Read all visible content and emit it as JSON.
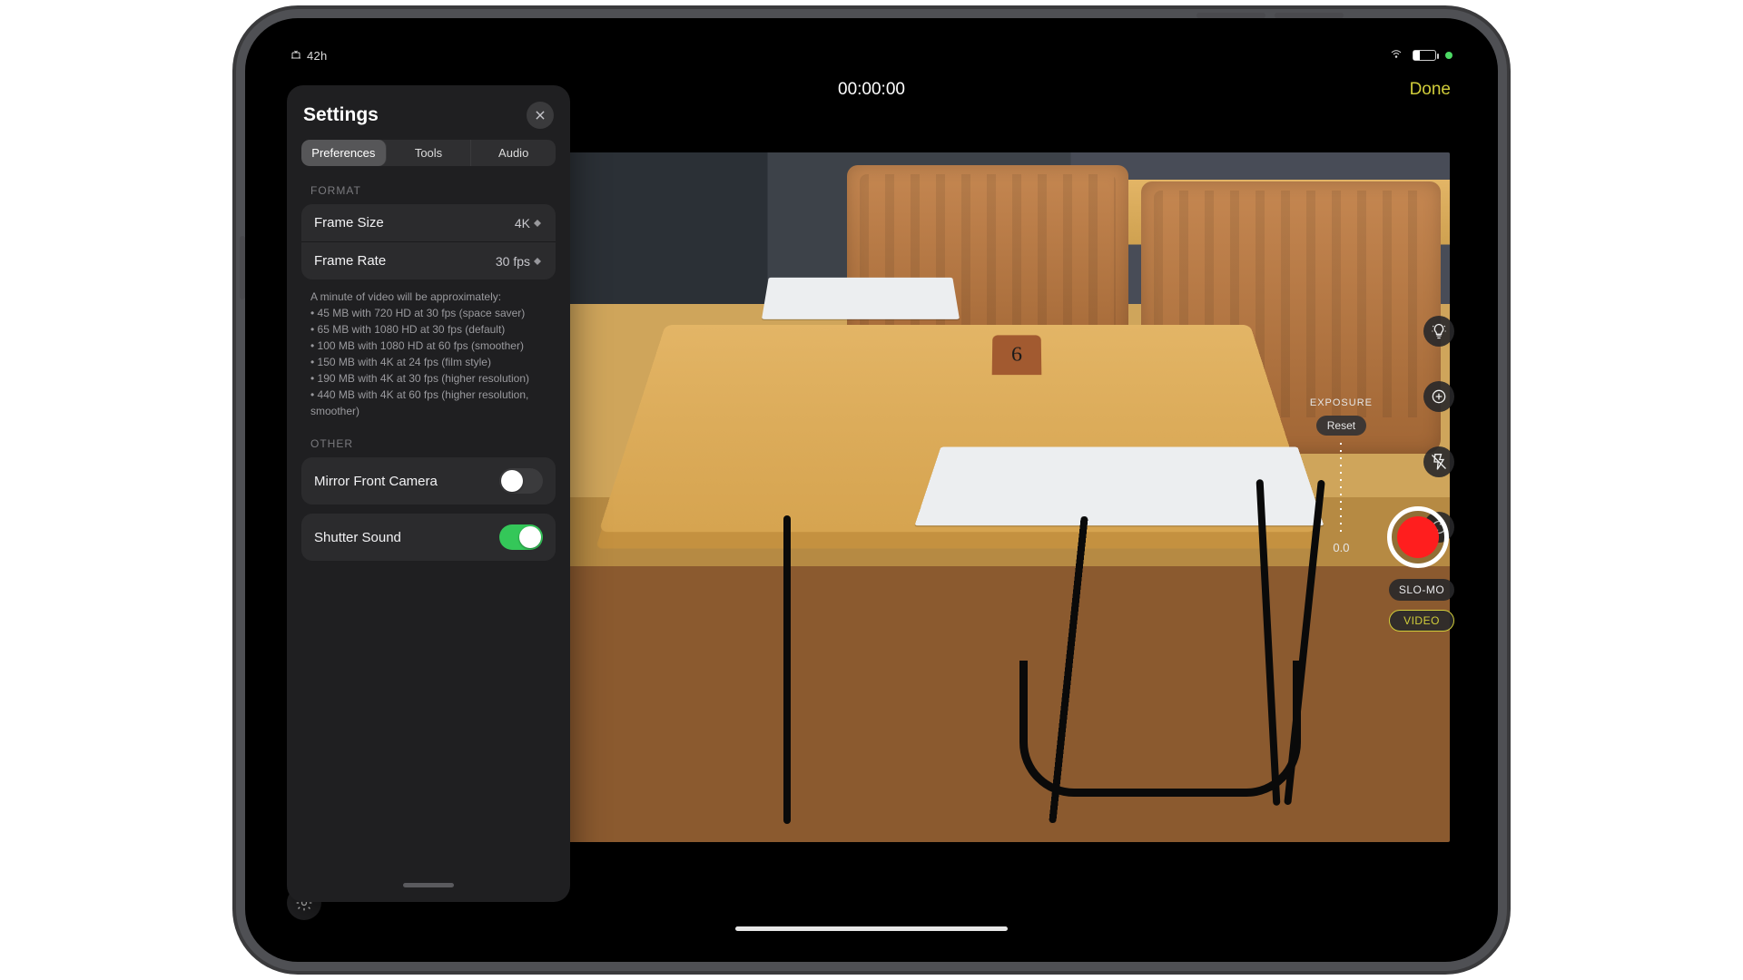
{
  "status": {
    "time": "42h"
  },
  "topbar": {
    "timer": "00:00:00",
    "done": "Done"
  },
  "viewfinder": {
    "card_number": "6"
  },
  "settings": {
    "title": "Settings",
    "tabs": {
      "preferences": "Preferences",
      "tools": "Tools",
      "audio": "Audio"
    },
    "format": {
      "label": "FORMAT",
      "frame_size": {
        "label": "Frame Size",
        "value": "4K"
      },
      "frame_rate": {
        "label": "Frame Rate",
        "value": "30 fps"
      },
      "footnote_intro": "A minute of video will be approximately:",
      "footnote_bullets": [
        "• 45 MB with 720 HD at 30 fps (space saver)",
        "• 65 MB with 1080 HD at 30 fps (default)",
        "• 100 MB with 1080 HD at 60 fps (smoother)",
        "• 150 MB with 4K at 24 fps (film style)",
        "• 190 MB with 4K at 30 fps (higher resolution)",
        "• 440 MB with 4K at 60 fps (higher resolution, smoother)"
      ]
    },
    "other": {
      "label": "OTHER",
      "mirror": {
        "label": "Mirror Front Camera",
        "on": false
      },
      "shutter": {
        "label": "Shutter Sound",
        "on": true
      }
    }
  },
  "exposure": {
    "label": "EXPOSURE",
    "reset": "Reset",
    "value": "0.0"
  },
  "modes": {
    "slomo": "SLO-MO",
    "video": "VIDEO"
  },
  "icons": {
    "bulb": "bulb-icon",
    "exposure": "exposure-icon",
    "flash": "flash-off-icon",
    "flip": "flip-camera-icon",
    "gear": "gear-icon",
    "close": "close-icon"
  }
}
